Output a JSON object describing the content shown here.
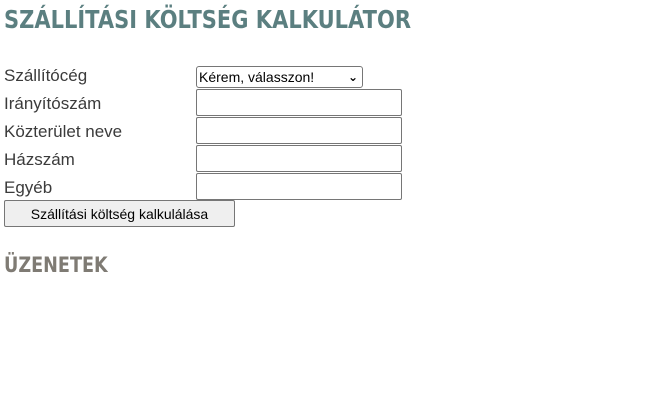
{
  "page": {
    "title": "SZÁLLÍTÁSI KÖLTSÉG KALKULÁTOR"
  },
  "form": {
    "carrier": {
      "label": "Szállítócég",
      "selected": "Kérem, válasszon!",
      "options": [
        "Kérem, válasszon!"
      ]
    },
    "zip": {
      "label": "Irányítószám",
      "value": ""
    },
    "street": {
      "label": "Közterület neve",
      "value": ""
    },
    "house_number": {
      "label": "Házszám",
      "value": ""
    },
    "other": {
      "label": "Egyéb",
      "value": ""
    },
    "submit_label": "Szállítási költség kalkulálása"
  },
  "messages": {
    "title": "ÜZENETEK"
  },
  "colors": {
    "title": "#5b7f80",
    "messages_title": "#7f7b74"
  },
  "icons": {
    "select_arrow": "chevron-down-icon"
  }
}
